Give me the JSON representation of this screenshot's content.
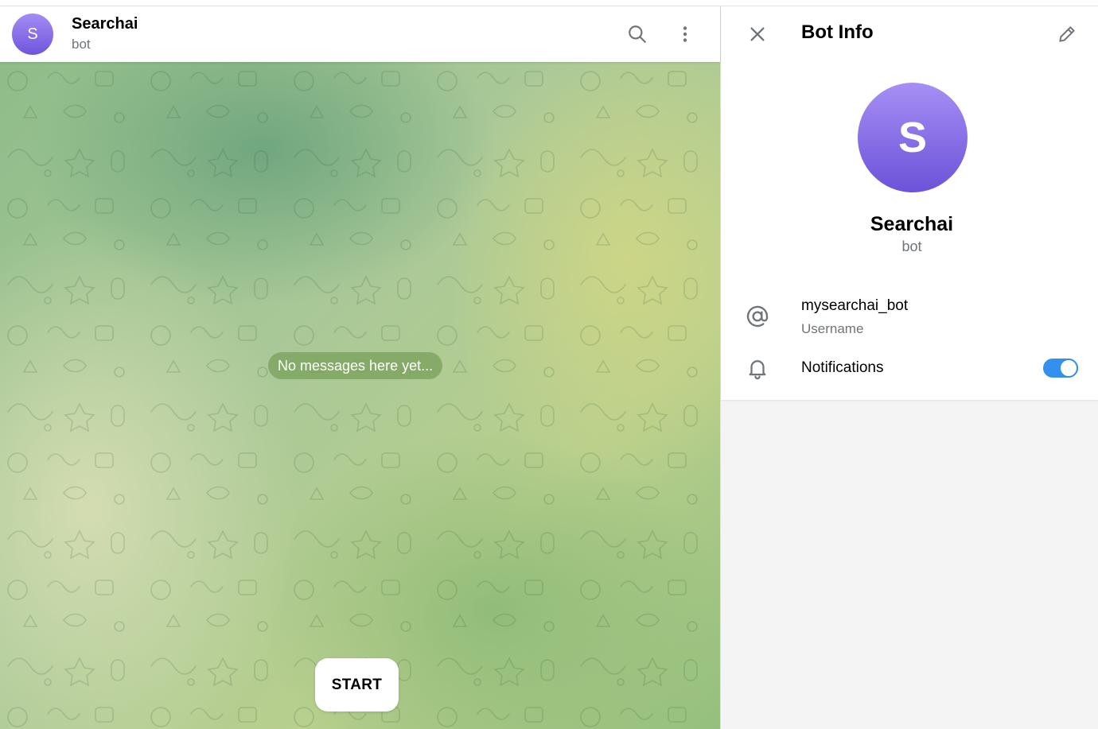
{
  "chat": {
    "avatar_letter": "S",
    "title": "Searchai",
    "subtitle": "bot",
    "empty_message": "No messages here yet...",
    "start_label": "START",
    "icons": {
      "search": "search-icon",
      "menu": "more-vertical-icon"
    }
  },
  "info_panel": {
    "title": "Bot Info",
    "avatar_letter": "S",
    "name": "Searchai",
    "subtitle": "bot",
    "username": "mysearchai_bot",
    "username_caption": "Username",
    "notifications_label": "Notifications",
    "notifications_enabled": true,
    "icons": {
      "close": "close-icon",
      "edit": "pencil-icon",
      "username": "at-sign-icon",
      "notifications": "bell-icon"
    }
  },
  "colors": {
    "accent": "#3390ec",
    "avatar_top": "#a48cf5",
    "avatar_bottom": "#6f55dc",
    "secondary_text": "#707579"
  }
}
